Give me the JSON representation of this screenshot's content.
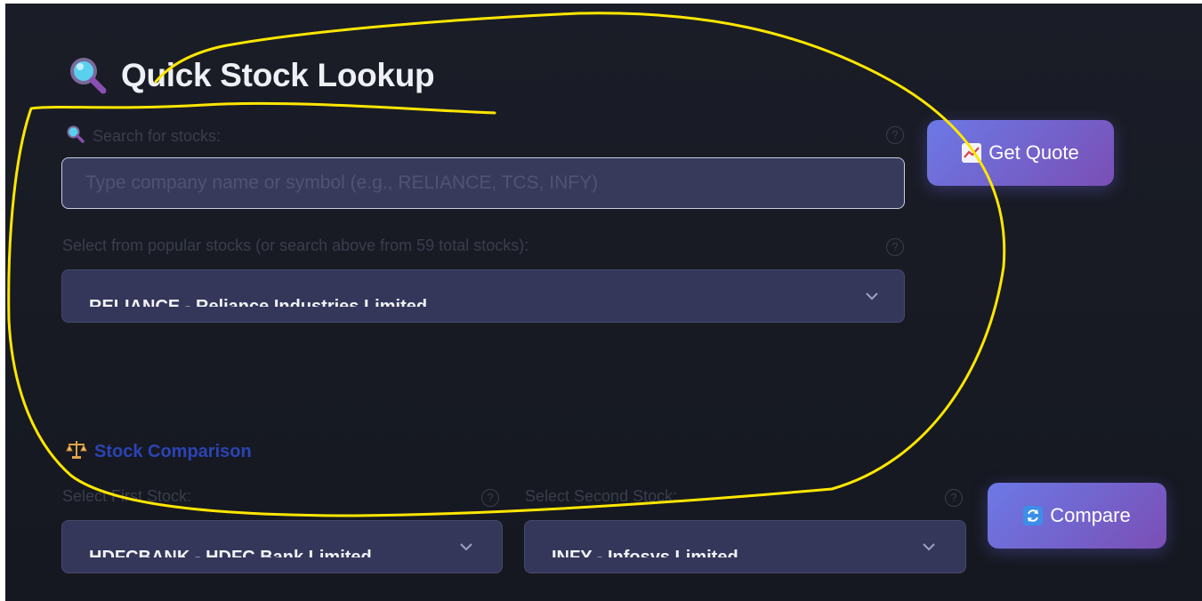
{
  "lookup": {
    "title": "Quick Stock Lookup",
    "title_icon": "magnifier-icon",
    "search": {
      "label": "Search for stocks:",
      "placeholder": "Type company name or symbol (e.g., RELIANCE, TCS, INFY)",
      "value": ""
    },
    "popular": {
      "label": "Select from popular stocks (or search above from 59 total stocks):",
      "selected": "RELIANCE - Reliance Industries Limited"
    },
    "get_quote_label": "Get Quote",
    "get_quote_icon": "chart-icon"
  },
  "comparison": {
    "heading": "Stock Comparison",
    "heading_icon": "balance-scale-icon",
    "first": {
      "label": "Select First Stock:",
      "selected": "HDFCBANK - HDFC Bank Limited"
    },
    "second": {
      "label": "Select Second Stock:",
      "selected": "INFY - Infosys Limited"
    },
    "compare_label": "Compare",
    "compare_icon": "refresh-icon"
  },
  "help_glyph": "?",
  "colors": {
    "background": "#171a23",
    "button_gradient_start": "#6c79e6",
    "button_gradient_end": "#7a4fb5",
    "annotation": "#ffe600",
    "section_heading": "#2c43b4"
  }
}
